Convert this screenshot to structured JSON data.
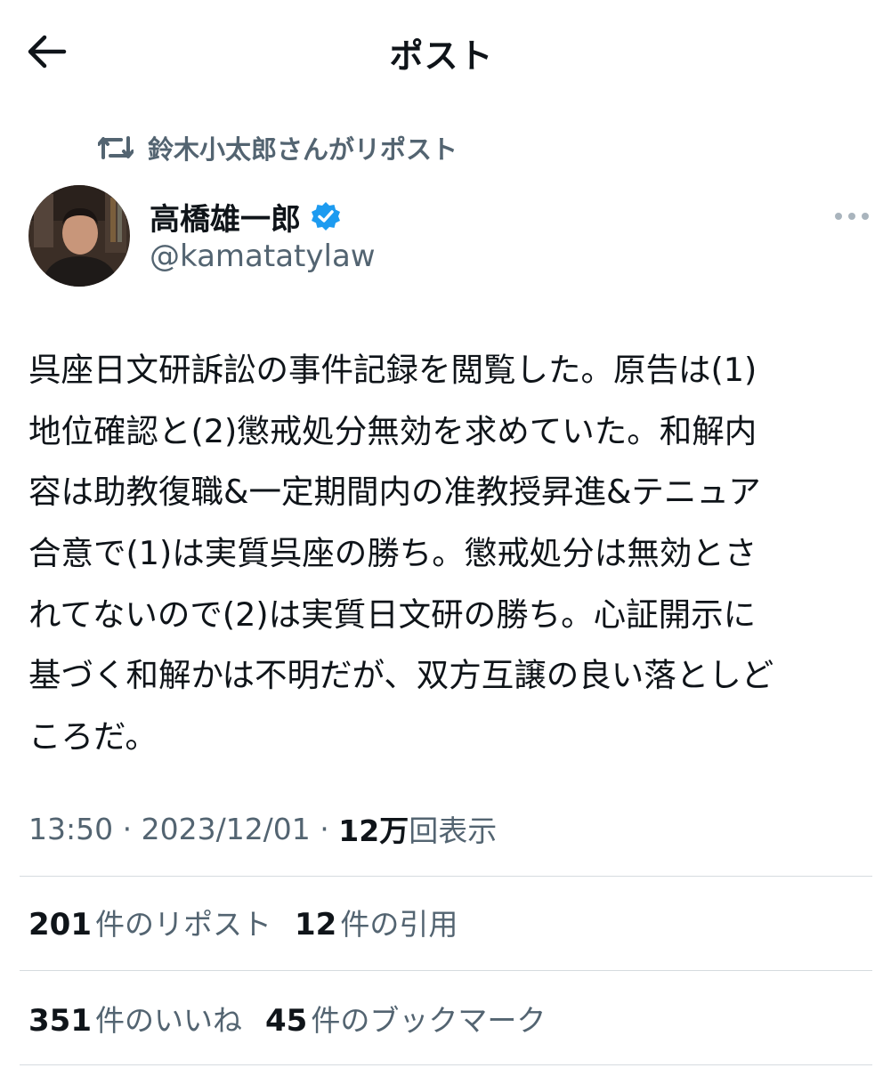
{
  "header": {
    "title": "ポスト"
  },
  "repost": {
    "text": "鈴木小太郎さんがリポスト"
  },
  "author": {
    "display_name": "高橋雄一郎",
    "handle": "@kamatatylaw"
  },
  "post": {
    "lines": [
      "呉座日文研訴訟の事件記録を閲覧した。原告は(1)",
      "地位確認と(2)懲戒処分無効を求めていた。和解内",
      "容は助教復職&一定期間内の准教授昇進&テニュア",
      "合意で(1)は実質呉座の勝ち。懲戒処分は無効とさ",
      "れてないので(2)は実質日文研の勝ち。心証開示に",
      "基づく和解かは不明だが、双方互譲の良い落としど",
      "ころだ。"
    ]
  },
  "meta": {
    "time": "13:50",
    "separator": " · ",
    "date": "2023/12/01",
    "views_count": "12万",
    "views_label": "回表示"
  },
  "stats": {
    "reposts": {
      "count": "201",
      "label": "件のリポスト"
    },
    "quotes": {
      "count": "12",
      "label": "件の引用"
    },
    "likes": {
      "count": "351",
      "label": "件のいいね"
    },
    "bookmarks": {
      "count": "45",
      "label": "件のブックマーク"
    }
  },
  "colors": {
    "text_primary": "#0f1419",
    "text_secondary": "#536471",
    "verified_blue": "#1d9bf0",
    "divider": "#d6dbdf"
  },
  "icons": {
    "back": "arrow-left-icon",
    "repost": "repost-icon",
    "verified": "verified-badge-icon",
    "more": "more-dots-icon"
  }
}
